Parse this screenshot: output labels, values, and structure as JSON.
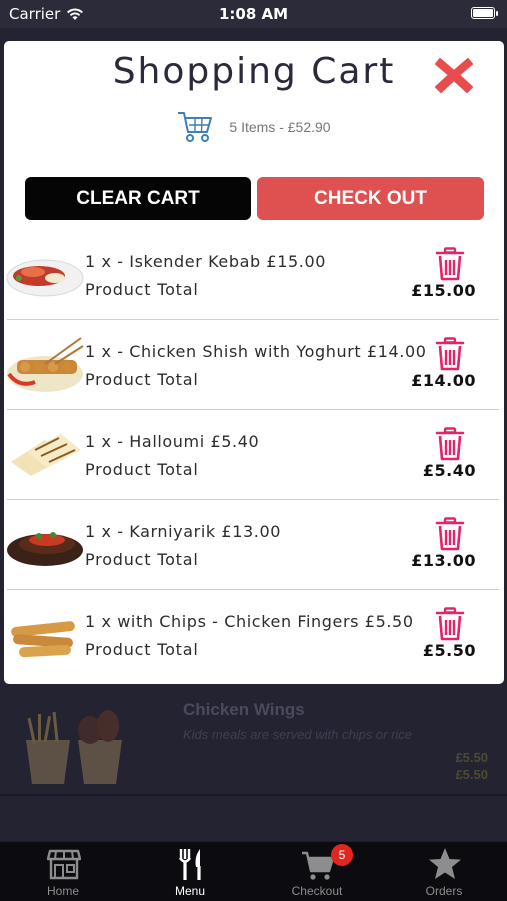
{
  "status_bar": {
    "carrier": "Carrier",
    "time": "1:08 AM"
  },
  "background_menu": {
    "item": {
      "title": "Chicken Wings",
      "description": "Kids meals are served with chips or rice",
      "prices": [
        "£5.50",
        "£5.50"
      ]
    }
  },
  "cart": {
    "title": "Shopping Cart",
    "summary": "5 Items - £52.90",
    "clear_label": "CLEAR CART",
    "checkout_label": "CHECK OUT",
    "items": [
      {
        "name": "1 x - Iskender Kebab £15.00",
        "subtotal_label": "Product Total",
        "total": "£15.00",
        "image": "kebab-plate"
      },
      {
        "name": "1 x - Chicken Shish with Yoghurt £14.00",
        "subtotal_label": "Product Total",
        "total": "£14.00",
        "image": "shish-plate"
      },
      {
        "name": "1 x - Halloumi £5.40",
        "subtotal_label": "Product Total",
        "total": "£5.40",
        "image": "halloumi-wrap"
      },
      {
        "name": "1 x - Karniyarik £13.00",
        "subtotal_label": "Product Total",
        "total": "£13.00",
        "image": "aubergine-dish"
      },
      {
        "name": "1 x with Chips - Chicken Fingers £5.50",
        "subtotal_label": "Product Total",
        "total": "£5.50",
        "image": "chicken-fingers"
      }
    ]
  },
  "tabs": [
    {
      "label": "Home",
      "icon": "store-icon",
      "active": false
    },
    {
      "label": "Menu",
      "icon": "fork-knife-icon",
      "active": true
    },
    {
      "label": "Checkout",
      "icon": "cart-icon",
      "active": false,
      "badge": "5"
    },
    {
      "label": "Orders",
      "icon": "star-icon",
      "active": false
    }
  ],
  "colors": {
    "accent": "#e3236a",
    "checkout": "#df5151",
    "clear": "#050505",
    "badge": "#e0261f"
  }
}
